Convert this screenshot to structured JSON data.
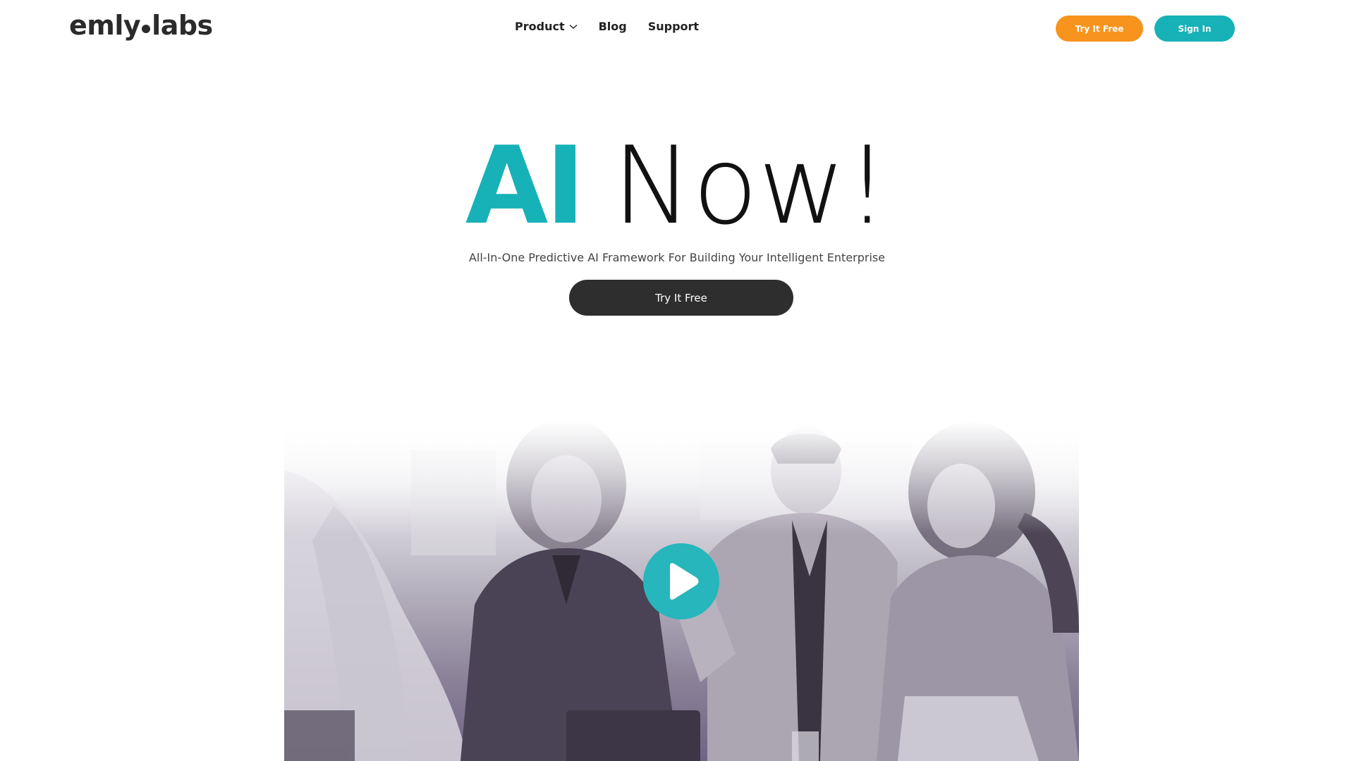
{
  "header": {
    "logo": {
      "left_text": "emly",
      "right_text": "labs"
    },
    "nav": {
      "product": "Product",
      "blog": "Blog",
      "support": "Support"
    },
    "try_free_label": "Try It Free",
    "sign_in_label": "Sign In"
  },
  "hero": {
    "title_accent": "AI",
    "title_rest": "Now!",
    "subtitle": "All-In-One Predictive AI Framework For Building Your Intelligent Enterprise",
    "cta_label": "Try It Free"
  },
  "video": {
    "play_icon": "play-icon"
  },
  "colors": {
    "accent_teal": "#17b1b8",
    "accent_orange": "#f7941d",
    "dark_button": "#2e2e2e",
    "text_dark": "#111111"
  }
}
